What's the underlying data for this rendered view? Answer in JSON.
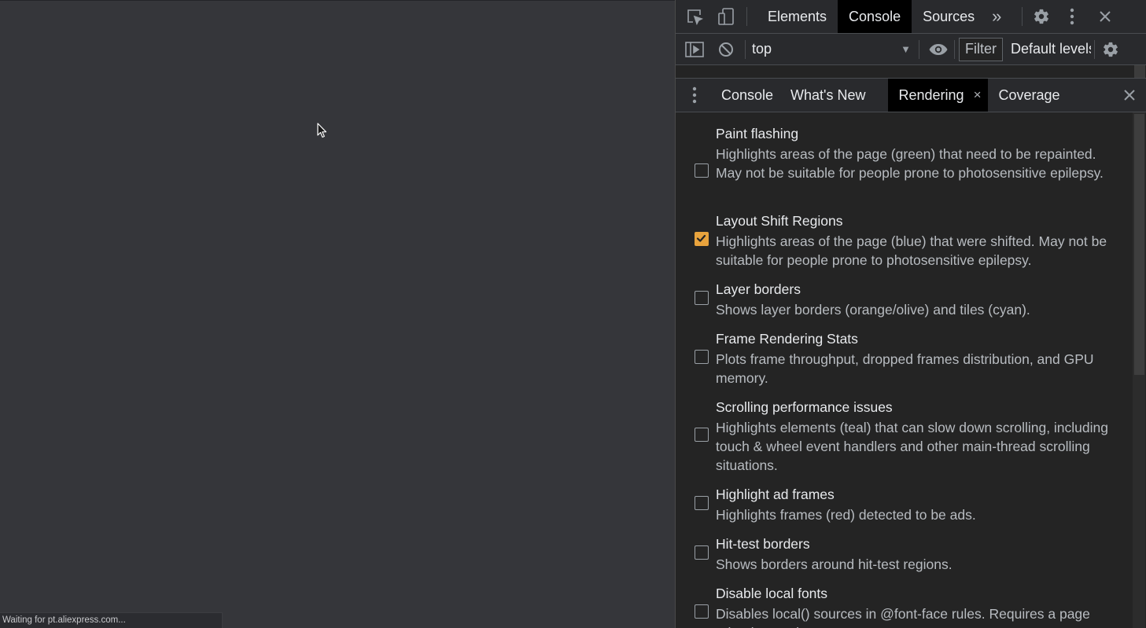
{
  "statusbar": {
    "text": "Waiting for pt.aliexpress.com..."
  },
  "devtools": {
    "main_tabs": [
      {
        "label": "Elements",
        "active": false
      },
      {
        "label": "Console",
        "active": true
      },
      {
        "label": "Sources",
        "active": false
      }
    ],
    "more_tabs_glyph": "»",
    "close_glyph": "✕",
    "console_toolbar": {
      "context": "top",
      "filter_placeholder": "Filter",
      "levels": "Default levels"
    },
    "drawer_tabs": [
      {
        "label": "Console",
        "active": false,
        "closable": false
      },
      {
        "label": "What's New",
        "active": false,
        "closable": false
      },
      {
        "label": "Rendering",
        "active": true,
        "closable": true
      },
      {
        "label": "Coverage",
        "active": false,
        "closable": false
      }
    ],
    "tab_close_glyph": "×",
    "accent_color": "#e8a33d",
    "rendering_options": [
      {
        "title": "Paint flashing",
        "description": "Highlights areas of the page (green) that need to be repainted. May not be suitable for people prone to photosensitive epilepsy.",
        "checked": false
      },
      {
        "title": "Layout Shift Regions",
        "description": "Highlights areas of the page (blue) that were shifted. May not be suitable for people prone to photosensitive epilepsy.",
        "checked": true
      },
      {
        "title": "Layer borders",
        "description": "Shows layer borders (orange/olive) and tiles (cyan).",
        "checked": false
      },
      {
        "title": "Frame Rendering Stats",
        "description": "Plots frame throughput, dropped frames distribution, and GPU memory.",
        "checked": false
      },
      {
        "title": "Scrolling performance issues",
        "description": "Highlights elements (teal) that can slow down scrolling, including touch & wheel event handlers and other main-thread scrolling situations.",
        "checked": false
      },
      {
        "title": "Highlight ad frames",
        "description": "Highlights frames (red) detected to be ads.",
        "checked": false
      },
      {
        "title": "Hit-test borders",
        "description": "Shows borders around hit-test regions.",
        "checked": false
      },
      {
        "title": "Disable local fonts",
        "description": "Disables local() sources in @font-face rules. Requires a page reload to apply.",
        "checked": false
      }
    ]
  }
}
